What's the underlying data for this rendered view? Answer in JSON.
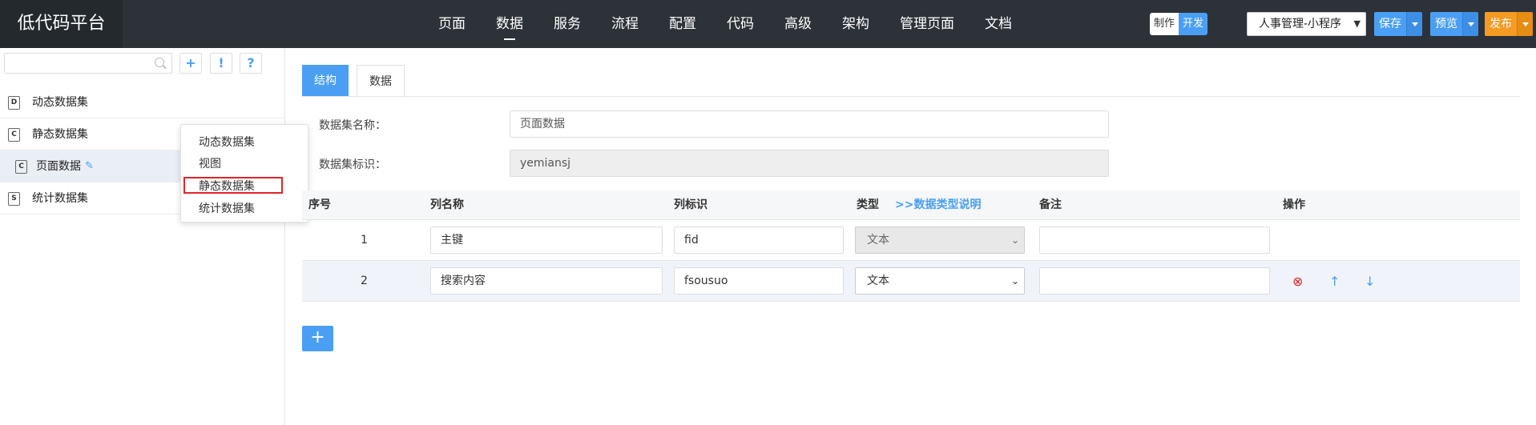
{
  "header": {
    "brand": "低代码平台",
    "nav": [
      "页面",
      "数据",
      "服务",
      "流程",
      "配置",
      "代码",
      "高级",
      "架构",
      "管理页面",
      "文档"
    ],
    "active_nav": "数据",
    "mode_make": "制作",
    "mode_dev": "开发",
    "project": "人事管理-小程序",
    "save_label": "保存",
    "preview_label": "预览",
    "publish_label": "发布"
  },
  "sidebar": {
    "search_placeholder": "",
    "add_icon": "+",
    "warn_icon": "!",
    "help_icon": "?",
    "items": [
      {
        "icon": "D",
        "label": "动态数据集"
      },
      {
        "icon": "C",
        "label": "静态数据集"
      },
      {
        "icon": "C",
        "label": "页面数据"
      },
      {
        "icon": "S",
        "label": "统计数据集"
      }
    ],
    "dropdown": [
      "动态数据集",
      "视图",
      "静态数据集",
      "统计数据集"
    ]
  },
  "main": {
    "tabs": [
      "结构",
      "数据"
    ],
    "name_label": "数据集名称：",
    "name_value": "页面数据",
    "id_label": "数据集标识：",
    "id_value": "yemiansj",
    "columns": {
      "seq": "序号",
      "col_name": "列名称",
      "col_id": "列标识",
      "type": "类型",
      "type_help": ">>数据类型说明",
      "remark": "备注",
      "ops": "操作"
    },
    "rows": [
      {
        "seq": "1",
        "name": "主键",
        "id": "fid",
        "type": "文本",
        "remark": ""
      },
      {
        "seq": "2",
        "name": "搜索内容",
        "id": "fsousuo",
        "type": "文本",
        "remark": ""
      }
    ],
    "add_row_icon": "+"
  },
  "colors": {
    "topbar": "#2d3238",
    "accent_blue": "#4a9ff5",
    "accent_orange": "#f59a23",
    "danger_red": "#e0242a"
  }
}
